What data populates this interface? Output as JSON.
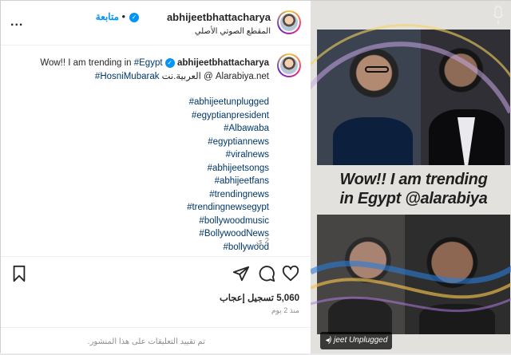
{
  "header": {
    "username": "abhijeetbhattacharya",
    "follow_label": "متابعة",
    "separator": "•",
    "audio_label": "المقطع الصوتي الأصلي",
    "more_label": "..."
  },
  "caption": {
    "username": "abhijeetbhattacharya",
    "line1_text": "Wow!! I am trending in",
    "line1_tag": "#Egypt",
    "line2_tag": "#HosniMubarak",
    "line2_text": "العربية.نت @ Alarabiya.net",
    "hashtags": [
      "#abhijeetunplugged",
      "#egyptianpresident",
      "#Albawaba",
      "#egyptiannews",
      "#viralnews",
      "#abhijeetsongs",
      "#abhijeetfans",
      "#trendingnews",
      "#trendingnewsegypt",
      "#bollywoodmusic",
      "#BollywoodNews",
      "#bollywood"
    ],
    "time": "2 ي"
  },
  "actions": {
    "likes_count": "5,060",
    "likes_label": "تسجيل إعجاب",
    "posted_ago": "منذ 2 يوم",
    "comments_limited": "تم تقييد التعليقات على هذا المنشور."
  },
  "media": {
    "banner_line1": "Wow!! I am trending",
    "banner_line2": "in Egypt @alarabiya",
    "watermark": "jeet Unplugged"
  },
  "colors": {
    "link": "#00376b",
    "follow": "#0095f6",
    "verified": "#0095f6",
    "muted": "#8e8e8e"
  }
}
